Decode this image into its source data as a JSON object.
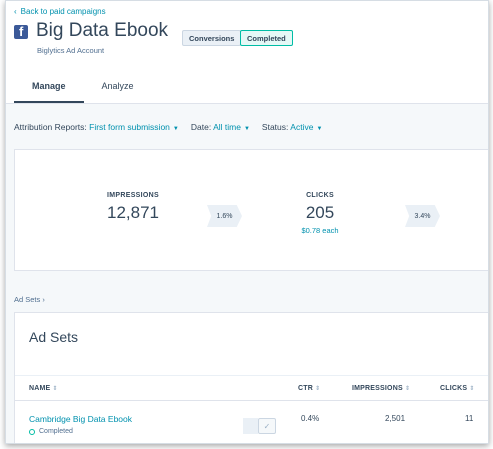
{
  "header": {
    "back_link": "Back to paid campaigns",
    "title": "Big Data Ebook",
    "subtitle": "Biglytics Ad Account",
    "tags": [
      "Conversions",
      "Completed"
    ],
    "tabs": [
      {
        "label": "Manage"
      },
      {
        "label": "Analyze"
      }
    ]
  },
  "filters": {
    "attribution": {
      "label": "Attribution Reports:",
      "value": "First form submission"
    },
    "date": {
      "label": "Date:",
      "value": "All time"
    },
    "status": {
      "label": "Status:",
      "value": "Active"
    }
  },
  "stats": {
    "impressions": {
      "label": "IMPRESSIONS",
      "value": "12,871"
    },
    "rate1": "1.6%",
    "clicks": {
      "label": "CLICKS",
      "value": "205",
      "sub": "$0.78 each"
    },
    "rate2": "3.4%"
  },
  "breadcrumb": "Ad Sets",
  "adsets": {
    "title": "Ad Sets",
    "columns": [
      "NAME",
      "CTR",
      "IMPRESSIONS",
      "CLICKS"
    ],
    "rows": [
      {
        "name": "Cambridge Big Data Ebook",
        "status": "Completed",
        "ctr": "0.4%",
        "impressions": "2,501",
        "clicks": "11"
      }
    ]
  },
  "colors": {
    "link": "#0091ae",
    "text": "#33475b",
    "completed": "#00bda5",
    "facebook": "#3b5998"
  },
  "icons": [
    "chevron-left-icon",
    "facebook-icon",
    "caret-down-icon",
    "sort-icon",
    "checkmark-icon",
    "status-dot-icon"
  ]
}
